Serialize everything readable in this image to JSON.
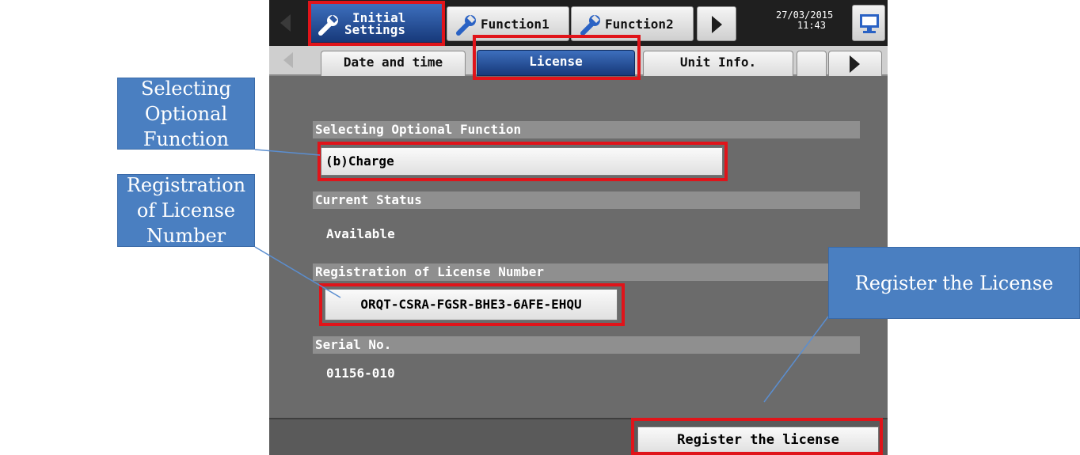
{
  "header": {
    "tabs": [
      {
        "line1": "Initial",
        "line2": "Settings",
        "active": true
      },
      {
        "label": "Function1"
      },
      {
        "label": "Function2"
      }
    ],
    "date": "27/03/2015",
    "time": "11:43"
  },
  "subtabs": {
    "date_time": "Date and time",
    "license": "License",
    "unit_info": "Unit Info."
  },
  "sections": {
    "optional_function": {
      "title": "Selecting Optional Function",
      "value": "(b)Charge"
    },
    "current_status": {
      "title": "Current Status",
      "value": "Available"
    },
    "license_number": {
      "title": "Registration of License Number",
      "value": "ORQT-CSRA-FGSR-BHE3-6AFE-EHQU"
    },
    "serial": {
      "title": "Serial No.",
      "value": "01156-010"
    }
  },
  "footer": {
    "register_label": "Register the license"
  },
  "callouts": {
    "optional_function": "Selecting Optional Function",
    "license_number": "Registration of License Number",
    "register": "Register the License"
  },
  "colors": {
    "active_tab": "#2a55a0",
    "highlight": "#e0141a",
    "callout": "#4a7fc1",
    "screen_bg": "#6b6b6b"
  }
}
